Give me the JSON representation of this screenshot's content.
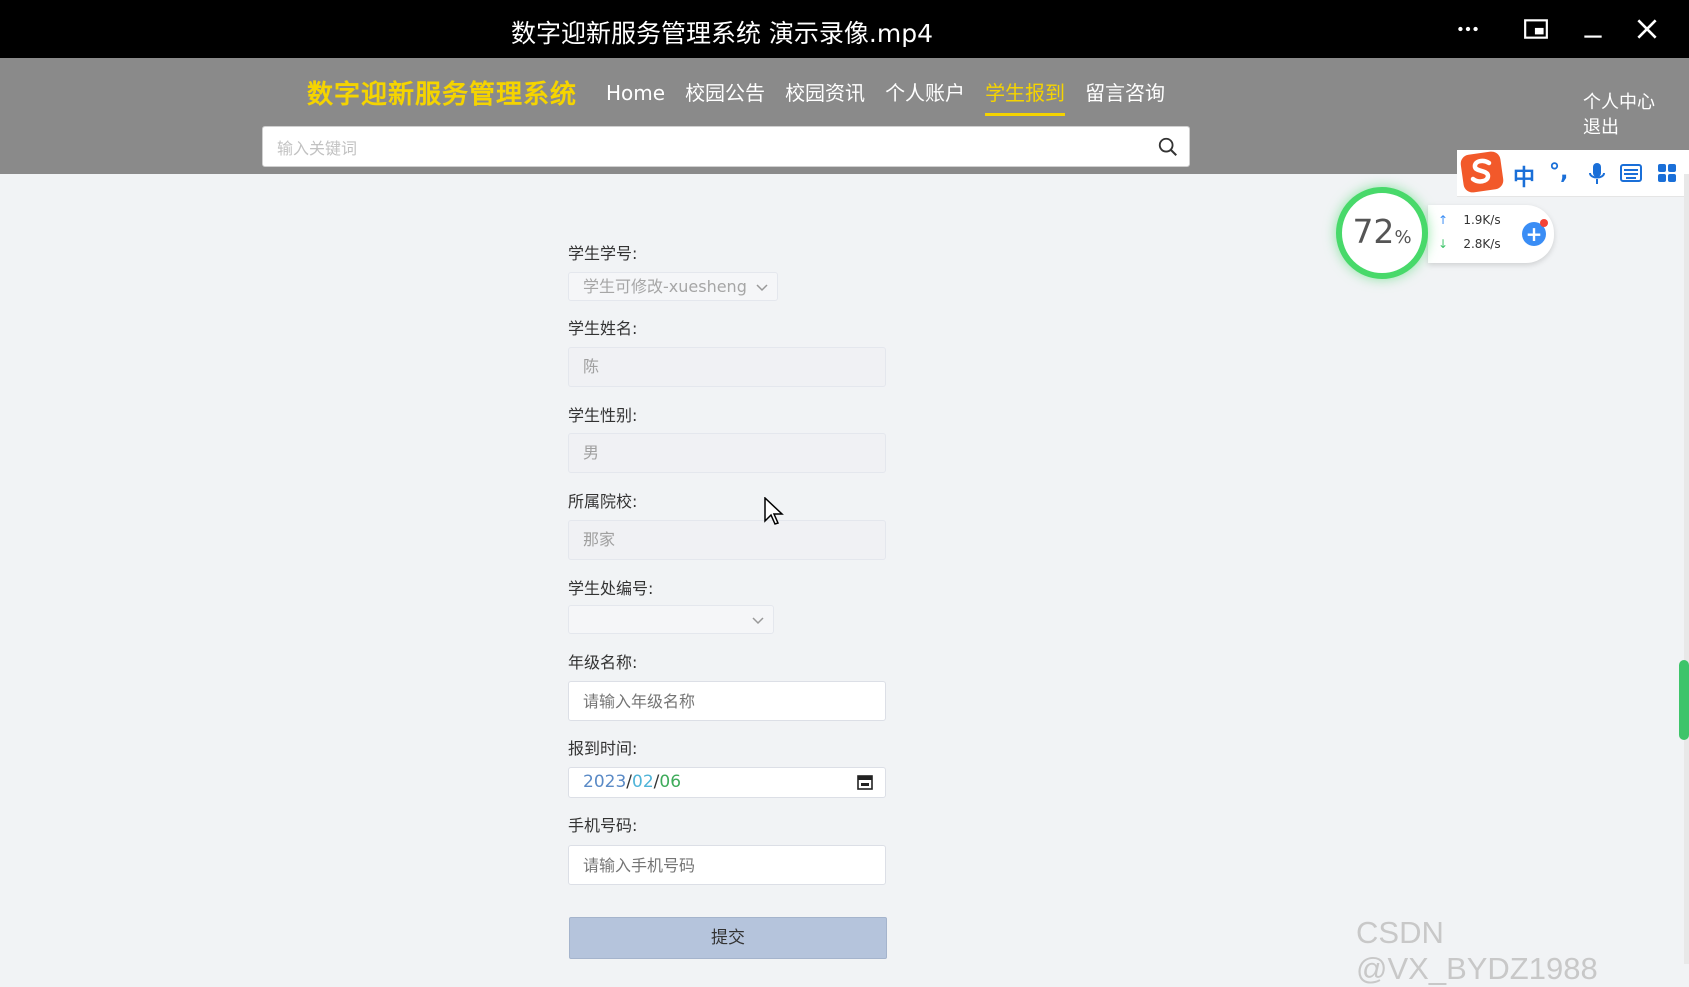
{
  "player": {
    "title": "数字迎新服务管理系统 演示录像.mp4",
    "buttons": {
      "more": "more-icon",
      "pip": "pip-icon",
      "minimize": "minimize-icon",
      "close": "close-icon"
    }
  },
  "header": {
    "brand": "数字迎新服务管理系统",
    "nav": [
      "Home",
      "校园公告",
      "校园资讯",
      "个人账户",
      "学生报到",
      "留言咨询"
    ],
    "active_nav": "学生报到",
    "user_links": {
      "profile": "个人中心",
      "logout": "退出"
    },
    "search": {
      "placeholder": "输入关键词",
      "icon": "search-icon"
    }
  },
  "form": {
    "student_id": {
      "label": "学生学号:",
      "value": "学生可修改-xuesheng"
    },
    "student_name": {
      "label": "学生姓名:",
      "value": "陈"
    },
    "student_gender": {
      "label": "学生性别:",
      "value": "男"
    },
    "college": {
      "label": "所属院校:",
      "value": "那家"
    },
    "office_no": {
      "label": "学生处编号:",
      "value": ""
    },
    "grade_name": {
      "label": "年级名称:",
      "placeholder": "请输入年级名称"
    },
    "report_time": {
      "label": "报到时间:",
      "year": "2023",
      "month": "02",
      "day": "06",
      "sep": "/"
    },
    "phone": {
      "label": "手机号码:",
      "placeholder": "请输入手机号码"
    },
    "submit": "提交"
  },
  "overlays": {
    "ime": {
      "lang": "中",
      "punct": "°,",
      "items": [
        "mic-icon",
        "keyboard-icon",
        "apps-icon"
      ]
    },
    "net": {
      "percent": "72",
      "percent_sign": "%",
      "up": "1.9K/s",
      "down": "2.8K/s"
    },
    "watermark": "CSDN @VX_BYDZ1988"
  },
  "colors": {
    "accent": "#f5d400",
    "header_bg": "#8a8a8a",
    "submit_bg": "#b5c4dc"
  }
}
